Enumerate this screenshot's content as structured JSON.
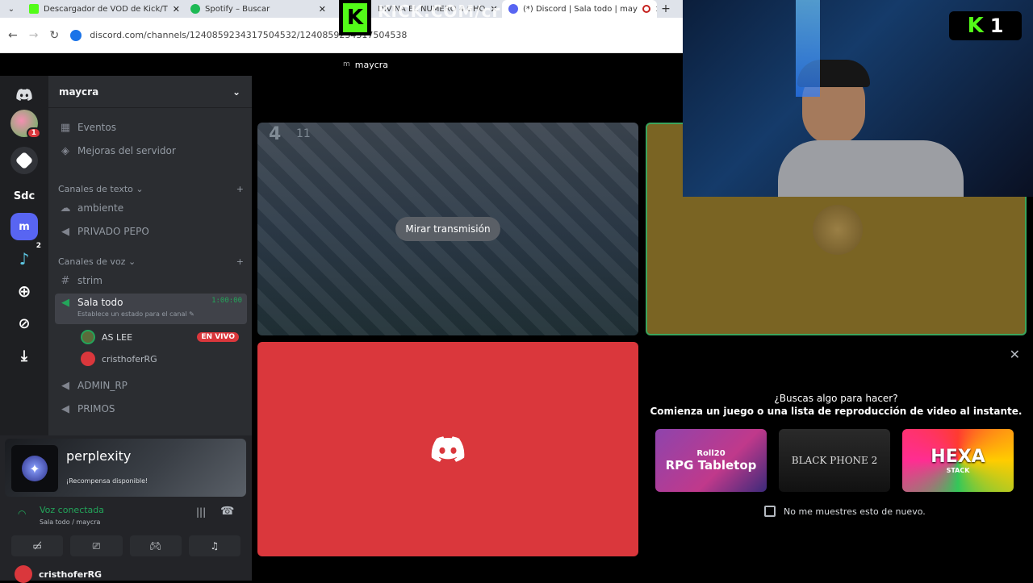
{
  "browser": {
    "tabs": [
      {
        "title": "Descargador de VOD de Kick/T",
        "fav_color": "#53fc18"
      },
      {
        "title": "Spotify – Buscar",
        "fav_color": "#1db954"
      },
      {
        "title": "DIVINA EL NUMERO 4 GHO",
        "fav_color": "#cccccc"
      },
      {
        "title": "(*) Discord | Sala todo | may",
        "fav_color": "#5865f2"
      }
    ],
    "url": "discord.com/channels/1240859234317504532/1240859234317504538",
    "watermark": "KICK.COM/cr"
  },
  "window_title": {
    "initial": "m",
    "name": "maycra"
  },
  "guilds": [
    "Sdc",
    "m"
  ],
  "guild_badges": {
    "pink": "1",
    "bot": "2"
  },
  "server": {
    "name": "maycra",
    "items": [
      {
        "label": "Eventos",
        "icon": "calendar-icon"
      },
      {
        "label": "Mejoras del servidor",
        "icon": "boost-icon"
      }
    ],
    "text_category": "Canales de texto",
    "text_channels": [
      "ambiente",
      "PRIVADO PEPO"
    ],
    "voice_category": "Canales de voz",
    "voice_channels": {
      "strim": "strim",
      "active": "Sala todo",
      "active_timer": "1:00:00",
      "status_hint": "Establece un estado para el canal",
      "members": [
        {
          "name": "AS LEE",
          "badge": "EN VIVO"
        },
        {
          "name": "cristhoferRG",
          "badge": ""
        }
      ],
      "others": [
        "ADMIN_RP",
        "PRIMOS"
      ]
    }
  },
  "promo": {
    "brand": "perplexity",
    "subtitle": "¡Recompensa disponible!"
  },
  "voice_panel": {
    "status": "Voz conectada",
    "location": "Sala todo / maycra"
  },
  "user": {
    "name": "cristhoferRG"
  },
  "stream": {
    "watch_label": "Mirar transmisión",
    "hud_number": "4",
    "hud_small": "11"
  },
  "activity": {
    "question": "¿Buscas algo para hacer?",
    "subtitle": "Comienza un juego o una lista de reproducción de video al instante.",
    "cards": [
      {
        "title": "RPG Tabletop",
        "small": "Roll20"
      },
      {
        "title": "BLACK PHONE 2",
        "small": ""
      },
      {
        "title": "HEXA",
        "small": "STACK"
      }
    ],
    "checkbox_label": "No me muestres esto de nuevo."
  },
  "kick_overlay": {
    "letter": "K",
    "count": "1"
  }
}
